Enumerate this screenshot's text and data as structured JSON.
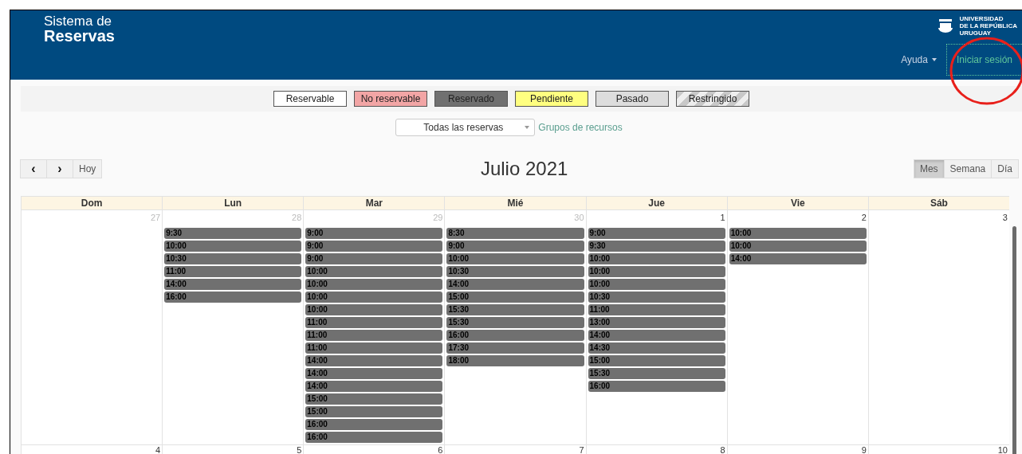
{
  "header": {
    "title_line_1": "Sistema de",
    "title_line_2": "Reservas",
    "logo_lines": [
      "UNIVERSIDAD",
      "DE LA REPÚBLICA",
      "URUGUAY"
    ],
    "nav": [
      {
        "label": "Ayuda",
        "kind": "dropdown",
        "highlighted": false
      },
      {
        "label": "Iniciar sesión",
        "kind": "link",
        "highlighted": true
      }
    ]
  },
  "legend": [
    {
      "label": "Reservable",
      "kind": "plain",
      "color": "#ffffff"
    },
    {
      "label": "No reservable",
      "kind": "plain",
      "color": "#f2a5a5"
    },
    {
      "label": "Reservado",
      "kind": "plain",
      "color": "#707070"
    },
    {
      "label": "Pendiente",
      "kind": "plain",
      "color": "#ffff80"
    },
    {
      "label": "Pasado",
      "kind": "plain",
      "color": "#dddddd"
    },
    {
      "label": "Restringido",
      "kind": "striped",
      "color": "#c8c8c8"
    }
  ],
  "filter": {
    "value": "Todas las reservas",
    "link": "Grupos de recursos"
  },
  "toolbar": {
    "prev": "‹",
    "next": "›",
    "today": "Hoy",
    "title": "Julio 2021",
    "views": [
      {
        "label": "Mes",
        "selected": true
      },
      {
        "label": "Semana",
        "selected": false
      },
      {
        "label": "Día",
        "selected": false
      }
    ]
  },
  "calendar": {
    "weekdays": [
      "Dom",
      "Lun",
      "Mar",
      "Mié",
      "Jue",
      "Vie",
      "Sáb"
    ],
    "weeks": [
      {
        "days": [
          {
            "number": "27",
            "other_month": true
          },
          {
            "number": "28",
            "other_month": true,
            "events": [
              "9:30",
              "10:00",
              "10:30",
              "11:00",
              "14:00",
              "16:00"
            ]
          },
          {
            "number": "29",
            "other_month": true,
            "events": [
              "9:00",
              "9:00",
              "9:00",
              "10:00",
              "10:00",
              "10:00",
              "10:00",
              "11:00",
              "11:00",
              "11:00",
              "14:00",
              "14:00",
              "14:00",
              "15:00",
              "15:00",
              "16:00",
              "16:00"
            ]
          },
          {
            "number": "30",
            "other_month": true,
            "events": [
              "8:30",
              "9:00",
              "10:00",
              "10:30",
              "14:00",
              "15:00",
              "15:30",
              "15:30",
              "16:00",
              "17:30",
              "18:00"
            ]
          },
          {
            "number": "1",
            "other_month": false,
            "events": [
              "9:00",
              "9:30",
              "10:00",
              "10:00",
              "10:00",
              "10:30",
              "11:00",
              "13:00",
              "14:00",
              "14:30",
              "15:00",
              "15:30",
              "16:00"
            ]
          },
          {
            "number": "2",
            "other_month": false,
            "events": [
              "10:00",
              "10:00",
              "14:00"
            ]
          },
          {
            "number": "3",
            "other_month": false
          }
        ]
      },
      {
        "days": [
          {
            "number": "4",
            "other_month": false
          },
          {
            "number": "5",
            "other_month": false
          },
          {
            "number": "6",
            "other_month": false
          },
          {
            "number": "7",
            "other_month": false
          },
          {
            "number": "8",
            "other_month": false
          },
          {
            "number": "9",
            "other_month": false
          },
          {
            "number": "10",
            "other_month": false
          }
        ]
      }
    ]
  }
}
